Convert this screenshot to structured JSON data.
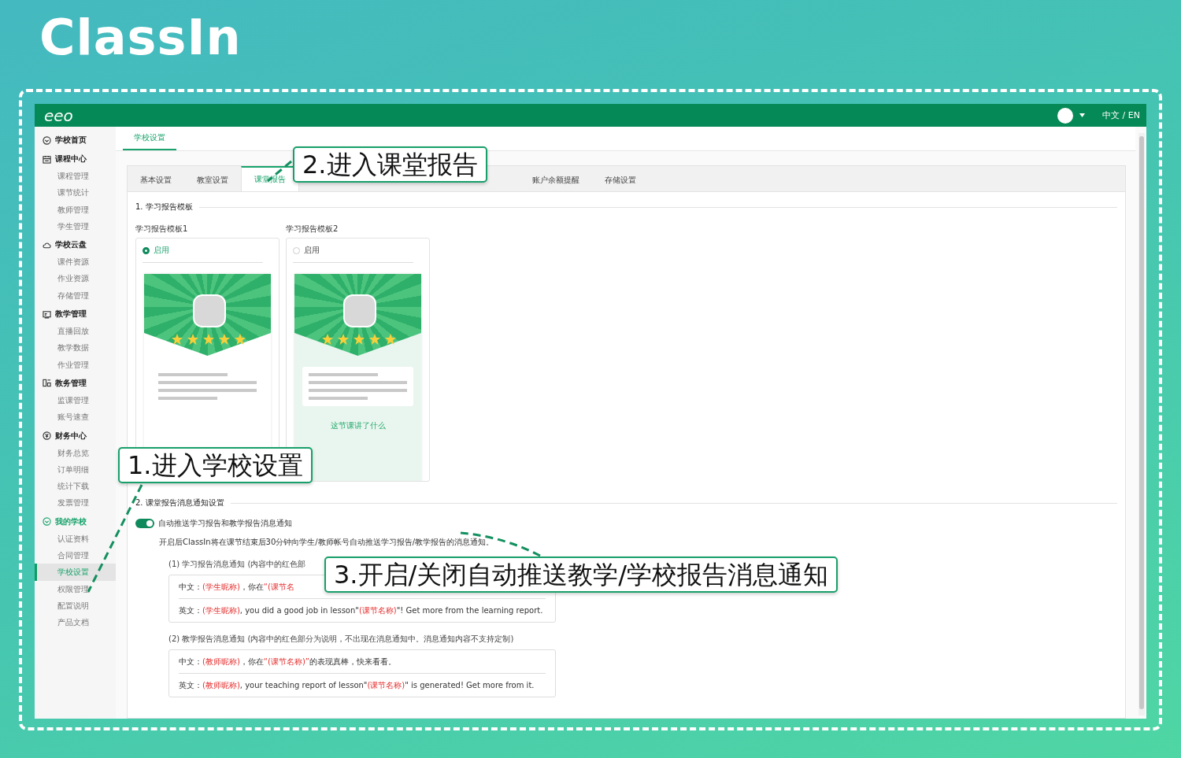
{
  "brand": {
    "logo": "ClassIn"
  },
  "app": {
    "logo": "eeo",
    "language": "中文 / EN"
  },
  "sidebar": {
    "groups": [
      {
        "label": "学校首页",
        "active": false
      },
      {
        "label": "课程中心",
        "active": false,
        "children": [
          {
            "label": "课程管理",
            "selected": false
          },
          {
            "label": "课节统计",
            "selected": false
          },
          {
            "label": "教师管理",
            "selected": false
          },
          {
            "label": "学生管理",
            "selected": false
          }
        ]
      },
      {
        "label": "学校云盘",
        "active": false,
        "children": [
          {
            "label": "课件资源",
            "selected": false
          },
          {
            "label": "作业资源",
            "selected": false
          },
          {
            "label": "存储管理",
            "selected": false
          }
        ]
      },
      {
        "label": "教学管理",
        "active": false,
        "children": [
          {
            "label": "直播回放",
            "selected": false
          },
          {
            "label": "教学数据",
            "selected": false
          },
          {
            "label": "作业管理",
            "selected": false
          }
        ]
      },
      {
        "label": "教务管理",
        "active": false,
        "children": [
          {
            "label": "监课管理",
            "selected": false
          },
          {
            "label": "账号速查",
            "selected": false
          }
        ]
      },
      {
        "label": "财务中心",
        "active": false,
        "children": [
          {
            "label": "财务总览",
            "selected": false
          },
          {
            "label": "订单明细",
            "selected": false
          },
          {
            "label": "统计下载",
            "selected": false
          },
          {
            "label": "发票管理",
            "selected": false
          }
        ]
      },
      {
        "label": "我的学校",
        "active": true,
        "children": [
          {
            "label": "认证资料",
            "selected": false
          },
          {
            "label": "合同管理",
            "selected": false
          },
          {
            "label": "学校设置",
            "selected": true
          },
          {
            "label": "权限管理",
            "selected": false
          },
          {
            "label": "配置说明",
            "selected": false
          },
          {
            "label": "产品文档",
            "selected": false
          }
        ]
      }
    ]
  },
  "top_tabs": [
    {
      "label": "学校设置",
      "selected": true
    }
  ],
  "settings_tabs": [
    {
      "label": "基本设置",
      "selected": false
    },
    {
      "label": "教室设置",
      "selected": false
    },
    {
      "label": "课堂报告",
      "selected": true
    },
    {
      "label": "账户余额提醒",
      "selected": false
    },
    {
      "label": "存储设置",
      "selected": false
    }
  ],
  "templates": {
    "title": "1. 学习报告模板",
    "items": [
      {
        "label": "学习报告模板1",
        "radio_label": "启用",
        "selected": true
      },
      {
        "label": "学习报告模板2",
        "radio_label": "启用",
        "selected": false,
        "section_title": "这节课讲了什么"
      }
    ]
  },
  "notifications": {
    "title": "2. 课堂报告消息通知设置",
    "toggle": {
      "label": "自动推送学习报告和教学报告消息通知",
      "on": true
    },
    "description": "开启后ClassIn将在课节结束后30分钟向学生/教师帐号自动推送学习报告/教学报告的消息通知。",
    "groups": [
      {
        "label": "(1) 学习报告消息通知 (内容中的红色部",
        "lines": [
          [
            {
              "text": "中文：",
              "note": false
            },
            {
              "text": "(学生昵称)",
              "note": true
            },
            {
              "text": "，你在",
              "note": false
            },
            {
              "text": "“(课节名",
              "note": true
            }
          ],
          [
            {
              "text": "英文：",
              "note": false
            },
            {
              "text": "(学生昵称)",
              "note": true
            },
            {
              "text": ", you did a good job in lesson\"",
              "note": false
            },
            {
              "text": "(课节名称)",
              "note": true
            },
            {
              "text": "\"! Get more from the learning report.",
              "note": false
            }
          ]
        ]
      },
      {
        "label": "(2) 教学报告消息通知 (内容中的红色部分为说明，不出现在消息通知中。消息通知内容不支持定制)",
        "lines": [
          [
            {
              "text": "中文：",
              "note": false
            },
            {
              "text": "(教师昵称)",
              "note": true
            },
            {
              "text": "，你在",
              "note": false
            },
            {
              "text": "“(课节名称)”",
              "note": true
            },
            {
              "text": "的表现真棒，快来看看。",
              "note": false
            }
          ],
          [
            {
              "text": "英文：",
              "note": false
            },
            {
              "text": "(教师昵称)",
              "note": true
            },
            {
              "text": ", your teaching report of lesson\"",
              "note": false
            },
            {
              "text": "(课节名称)",
              "note": true
            },
            {
              "text": "\" is generated! Get more from it.",
              "note": false
            }
          ]
        ]
      }
    ]
  },
  "callouts": [
    {
      "text": "1.进入学校设置"
    },
    {
      "text": "2.进入课堂报告"
    },
    {
      "text": "3.开启/关闭自动推送教学/学校报告消息通知"
    }
  ]
}
